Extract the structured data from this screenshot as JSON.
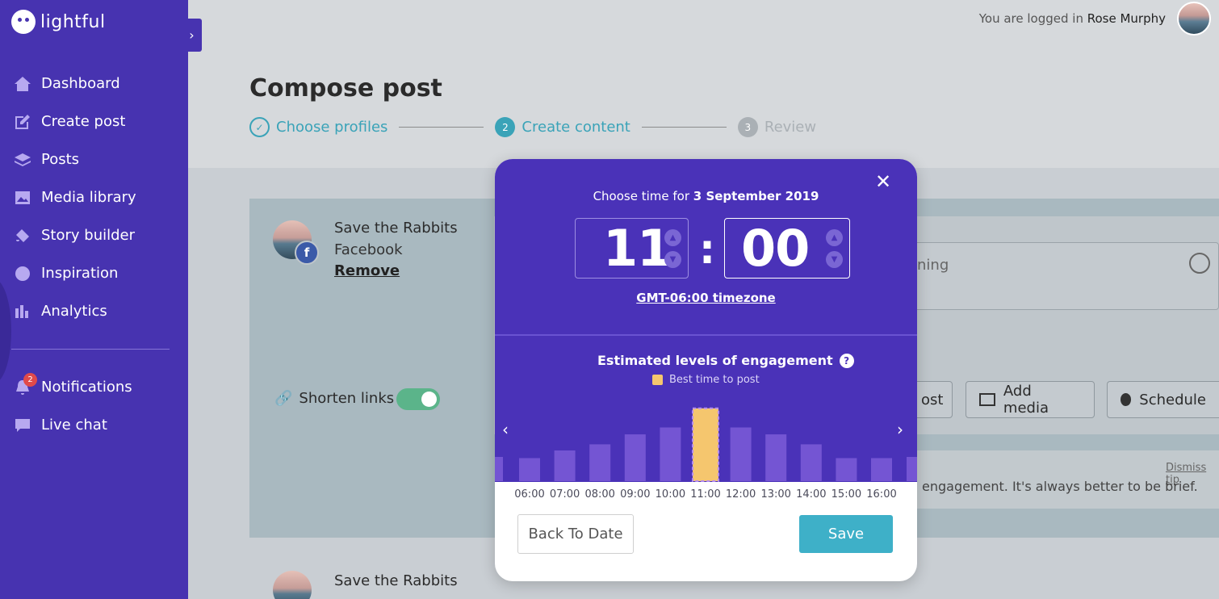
{
  "brand": {
    "name": "lightful"
  },
  "sidebar": {
    "items": [
      {
        "label": "Dashboard",
        "icon": "home-icon"
      },
      {
        "label": "Create post",
        "icon": "edit-icon"
      },
      {
        "label": "Posts",
        "icon": "stack-icon"
      },
      {
        "label": "Media library",
        "icon": "image-icon"
      },
      {
        "label": "Story builder",
        "icon": "paint-icon"
      },
      {
        "label": "Inspiration",
        "icon": "globe-icon"
      },
      {
        "label": "Analytics",
        "icon": "bar-chart-icon"
      }
    ],
    "secondary": [
      {
        "label": "Notifications",
        "icon": "bell-icon"
      },
      {
        "label": "Live chat",
        "icon": "chat-icon"
      }
    ],
    "notification_count": "2"
  },
  "topbar": {
    "login_prefix": "You are logged in",
    "user_name": "Rose Murphy"
  },
  "page": {
    "title": "Compose post",
    "steps": [
      {
        "label": "Choose profiles",
        "number": "✓"
      },
      {
        "label": "Create content",
        "number": "2"
      },
      {
        "label": "Review",
        "number": "3"
      }
    ]
  },
  "profile": {
    "name": "Save the Rabbits",
    "network": "Facebook",
    "remove": "Remove",
    "shorten_links": "Shorten links"
  },
  "composer": {
    "text_fragment": "ning",
    "button_post": "ost",
    "button_add_media": "Add media",
    "button_schedule": "Schedule",
    "tip_text": "engagement. It's always better to be brief.",
    "dismiss": "Dismiss tip"
  },
  "profile2": {
    "name": "Save the Rabbits"
  },
  "modal": {
    "choose_prefix": "Choose time for",
    "date": "3 September 2019",
    "hour": "11",
    "minute": "00",
    "colon": ":",
    "timezone": "GMT-06:00 timezone",
    "engagement_title": "Estimated levels of engagement",
    "legend_label": "Best time to post",
    "back_button": "Back To Date",
    "save_button": "Save"
  },
  "chart_data": {
    "type": "bar",
    "categories": [
      "06:00",
      "07:00",
      "08:00",
      "09:00",
      "10:00",
      "11:00",
      "12:00",
      "13:00",
      "14:00",
      "15:00",
      "16:00"
    ],
    "values": [
      30,
      40,
      48,
      61,
      70,
      95,
      70,
      61,
      48,
      30,
      30
    ],
    "highlight": "11:00",
    "colors": {
      "bar": "#7455d3",
      "highlight": "#f5c66e"
    }
  }
}
